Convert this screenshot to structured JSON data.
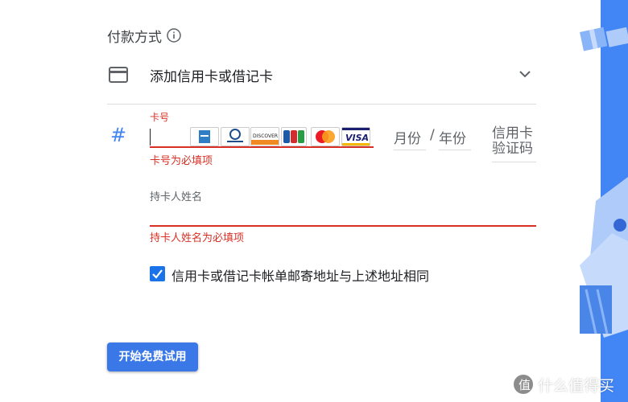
{
  "section": {
    "title": "付款方式"
  },
  "add_card": {
    "label": "添加信用卡或借记卡"
  },
  "card_number": {
    "label": "卡号",
    "error": "卡号为必填项",
    "brands": [
      "AMEX",
      "Diners Club",
      "DISCOVER",
      "JCB",
      "MasterCard",
      "VISA"
    ]
  },
  "expiry": {
    "month_placeholder": "月份",
    "separator": "/",
    "year_placeholder": "年份"
  },
  "cvc": {
    "placeholder": "信用卡验证码"
  },
  "cardholder": {
    "label": "持卡人姓名",
    "error": "持卡人姓名为必填项"
  },
  "billing": {
    "checked": true,
    "label": "信用卡或借记卡帐单邮寄地址与上述地址相同"
  },
  "actions": {
    "start_label": "开始免费试用"
  },
  "watermark": {
    "text": "什么值得买"
  },
  "colors": {
    "accent": "#4285f4",
    "error": "#d93025",
    "button": "#3b78e7"
  }
}
